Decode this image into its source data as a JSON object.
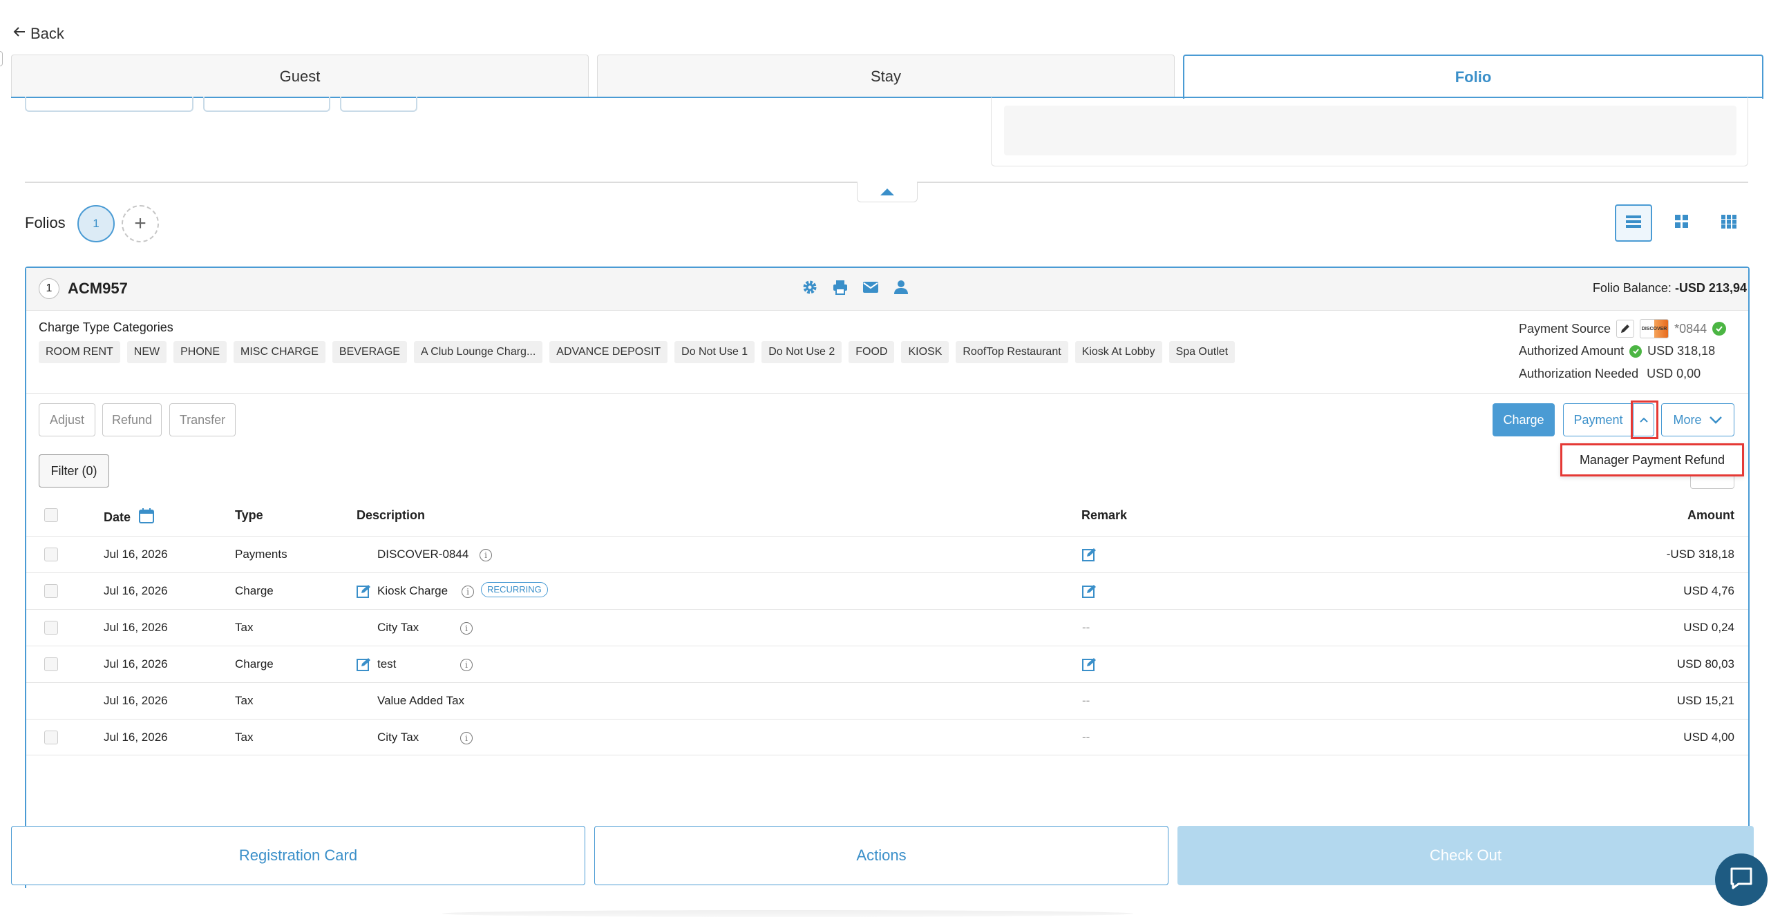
{
  "nav": {
    "back_label": "Back"
  },
  "tabs": [
    {
      "label": "Guest"
    },
    {
      "label": "Stay"
    },
    {
      "label": "Folio"
    }
  ],
  "folios": {
    "label": "Folios",
    "selected_number": "1",
    "add_symbol": "+"
  },
  "folio": {
    "number": "1",
    "name": "ACM957",
    "balance_label": "Folio Balance:",
    "balance_value": "-USD 213,94",
    "charge_type_label": "Charge Type Categories",
    "categories": [
      "ROOM RENT",
      "NEW",
      "PHONE",
      "MISC CHARGE",
      "BEVERAGE",
      "A Club Lounge Charg...",
      "ADVANCE DEPOSIT",
      "Do Not Use 1",
      "Do Not Use 2",
      "FOOD",
      "KIOSK",
      "RoofTop Restaurant",
      "Kiosk At Lobby",
      "Spa Outlet"
    ],
    "payment_source_label": "Payment Source",
    "card_brand": "DISCOVER",
    "card_mask": "*0844",
    "authorized_label": "Authorized Amount",
    "authorized_value": "USD 318,18",
    "auth_needed_label": "Authorization Needed",
    "auth_needed_value": "USD 0,00"
  },
  "actions": {
    "adjust": "Adjust",
    "refund": "Refund",
    "transfer": "Transfer",
    "charge": "Charge",
    "payment": "Payment",
    "more": "More",
    "filter": "Filter (0)",
    "dropdown_item": "Manager Payment Refund"
  },
  "table": {
    "headers": {
      "date": "Date",
      "type": "Type",
      "description": "Description",
      "remark": "Remark",
      "amount": "Amount"
    },
    "rows": [
      {
        "date": "Jul 16, 2026",
        "type": "Payments",
        "description": "DISCOVER-0844",
        "remark": "",
        "amount": "-USD 318,18"
      },
      {
        "date": "Jul 16, 2026",
        "type": "Charge",
        "description": "Kiosk Charge",
        "badge": "RECURRING",
        "remark": "",
        "amount": "USD 4,76"
      },
      {
        "date": "Jul 16, 2026",
        "type": "Tax",
        "description": "City Tax",
        "remark": "--",
        "amount": "USD 0,24"
      },
      {
        "date": "Jul 16, 2026",
        "type": "Charge",
        "description": "test",
        "remark": "",
        "amount": "USD 80,03"
      },
      {
        "date": "Jul 16, 2026",
        "type": "Tax",
        "description": "Value Added Tax",
        "remark": "--",
        "amount": "USD 15,21"
      },
      {
        "date": "Jul 16, 2026",
        "type": "Tax",
        "description": "City Tax",
        "remark": "--",
        "amount": "USD 4,00"
      }
    ]
  },
  "bottom": {
    "registration_card": "Registration Card",
    "actions": "Actions",
    "check_out": "Check Out"
  },
  "colors": {
    "accent": "#4a9bd4",
    "highlight": "#e53935",
    "success": "#4bb543",
    "chat": "#1e5b82"
  }
}
